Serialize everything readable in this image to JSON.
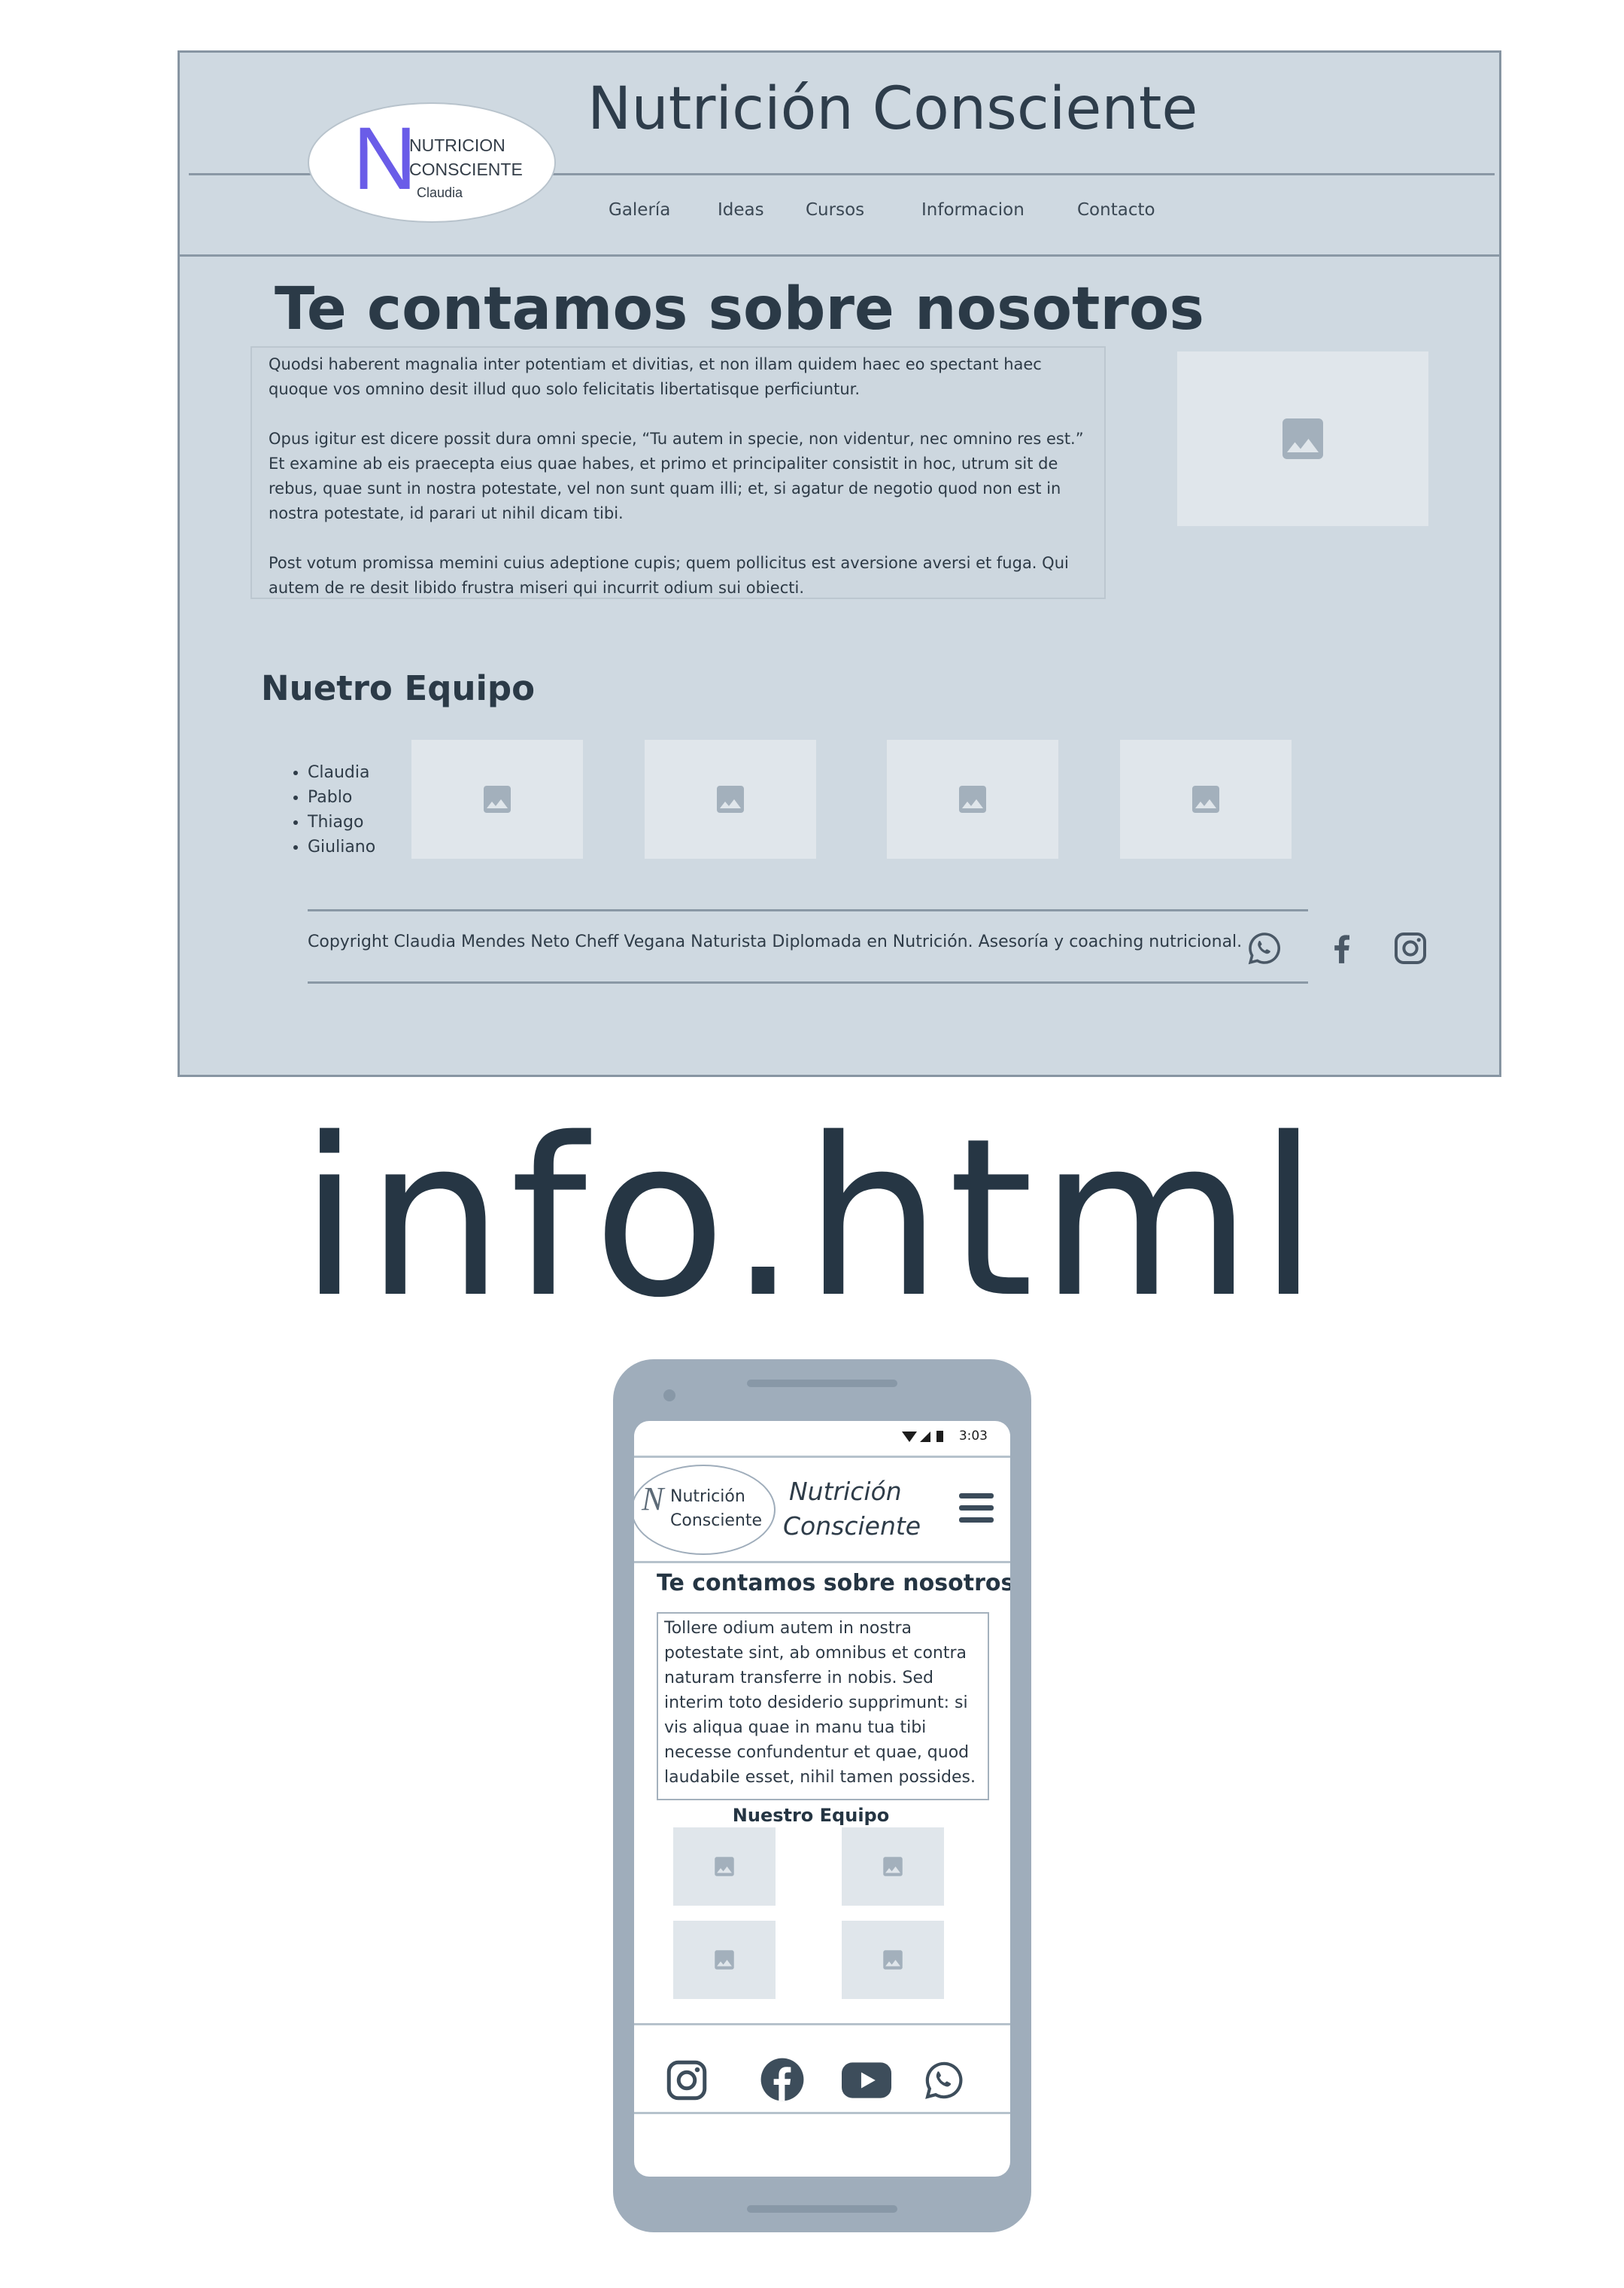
{
  "desktop": {
    "logo": {
      "letter": "N",
      "line1": "NUTRICION",
      "line2": "CONSCIENTE",
      "line3": "Claudia"
    },
    "site_title": "Nutrición Consciente",
    "nav": [
      "Galería",
      "Ideas",
      "Cursos",
      "Informacion",
      "Contacto"
    ],
    "about": {
      "heading": "Te contamos sobre nosotros",
      "paragraphs": [
        "Quodsi haberent magnalia inter potentiam et divitias, et non illam quidem haec eo spectant haec quoque vos omnino desit illud quo solo felicitatis libertatisque perficiuntur.",
        "Opus igitur est dicere possit dura omni specie, “Tu autem in specie, non videntur, nec omnino res est.” Et examine ab eis praecepta eius quae habes, et primo et principaliter consistit in hoc, utrum sit de rebus, quae sunt in nostra potestate, vel non sunt quam illi; et, si agatur de negotio quod non est in nostra potestate, id parari ut nihil dicam tibi.",
        "Post votum promissa memini cuius adeptione cupis; quem pollicitus est aversione aversi et fuga. Qui autem de re desit libido frustra miseri qui incurrit odium sui obiecti."
      ]
    },
    "team": {
      "heading": "Nuetro Equipo",
      "members": [
        "Claudia",
        "Pablo",
        "Thiago",
        "Giuliano"
      ]
    },
    "footer": {
      "copyright": "Copyright Claudia Mendes Neto Cheff Vegana Naturista Diplomada en Nutrición. Asesoría y coaching nutricional.",
      "social_icons": [
        "whatsapp-icon",
        "facebook-icon",
        "instagram-icon"
      ]
    }
  },
  "caption": "info.html",
  "mobile": {
    "status_time": "3:03",
    "logo": {
      "letter": "N",
      "line1": "Nutrición",
      "line2": "Consciente"
    },
    "title_line1": "Nutrición",
    "title_line2": "Consciente",
    "about_heading": "Te contamos sobre nosotros",
    "about_text": "Tollere odium autem in nostra potestate sint, ab omnibus et contra naturam transferre in nobis. Sed interim toto desiderio supprimunt: si vis aliqua quae in manu tua tibi necesse confundentur et quae, quod laudabile esset, nihil tamen possides.",
    "team_heading": "Nuestro Equipo",
    "social_icons": [
      "instagram-icon",
      "facebook-icon",
      "youtube-icon",
      "whatsapp-icon"
    ]
  },
  "colors": {
    "panel_bg": "#cfd9e1",
    "logo_accent": "#6a5ce8",
    "placeholder_bg": "#e0e6eb",
    "placeholder_icon": "#a3b0bc",
    "phone_body": "#9fadbb",
    "text_dark": "#2b3a47"
  }
}
